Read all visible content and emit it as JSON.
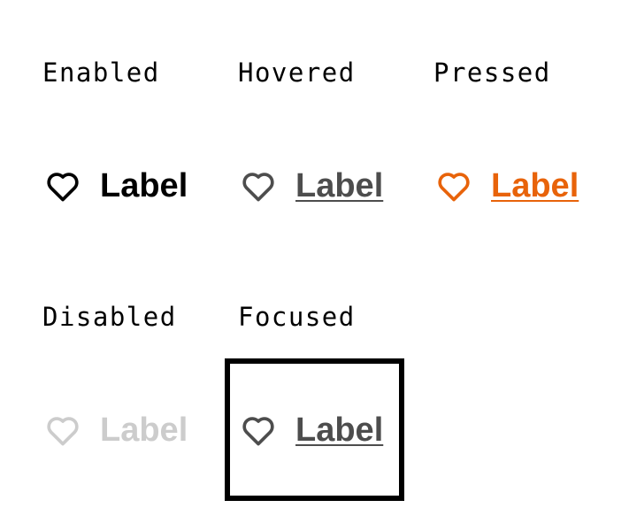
{
  "states": {
    "enabled": {
      "title": "Enabled",
      "label": "Label",
      "color": "#000000"
    },
    "hovered": {
      "title": "Hovered",
      "label": "Label",
      "color": "#4d4d4d"
    },
    "pressed": {
      "title": "Pressed",
      "label": "Label",
      "color": "#e8630a"
    },
    "disabled": {
      "title": "Disabled",
      "label": "Label",
      "color": "#cccccc"
    },
    "focused": {
      "title": "Focused",
      "label": "Label",
      "color": "#4d4d4d"
    }
  },
  "icon": "heart-icon"
}
